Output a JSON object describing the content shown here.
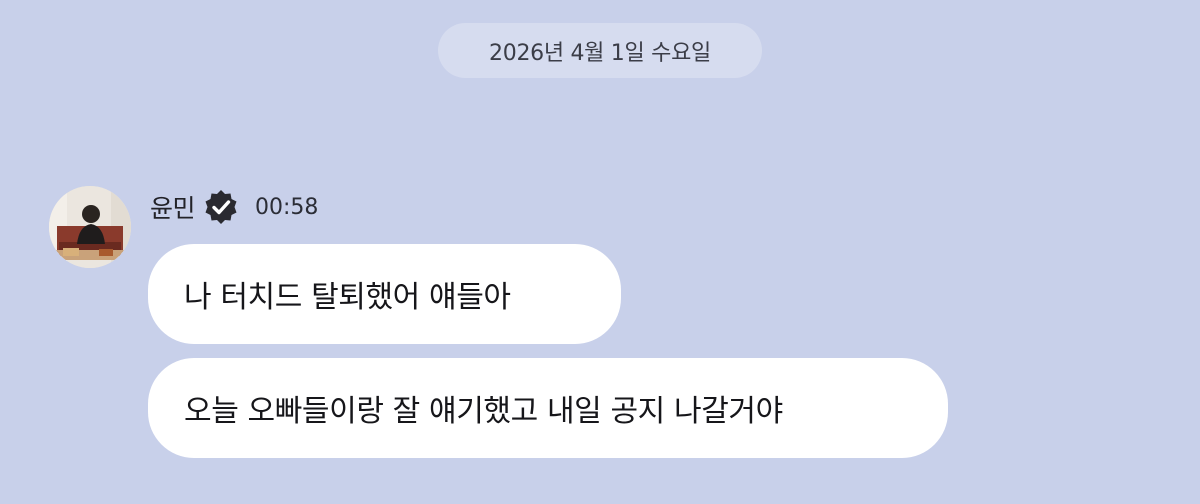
{
  "chat": {
    "date_divider": "2026년 4월 1일 수요일",
    "sender": {
      "name": "윤민",
      "verified_icon": "verified-badge-icon",
      "time": "00:58"
    },
    "messages": [
      {
        "text": "나 터치드 탈퇴했어 얘들아"
      },
      {
        "text": "오늘 오빠들이랑 잘 얘기했고 내일 공지 나갈거야"
      }
    ]
  },
  "colors": {
    "background": "#c8d0ea",
    "date_pill": "#d6dcef",
    "bubble": "#ffffff",
    "badge": "#2a2a30"
  }
}
